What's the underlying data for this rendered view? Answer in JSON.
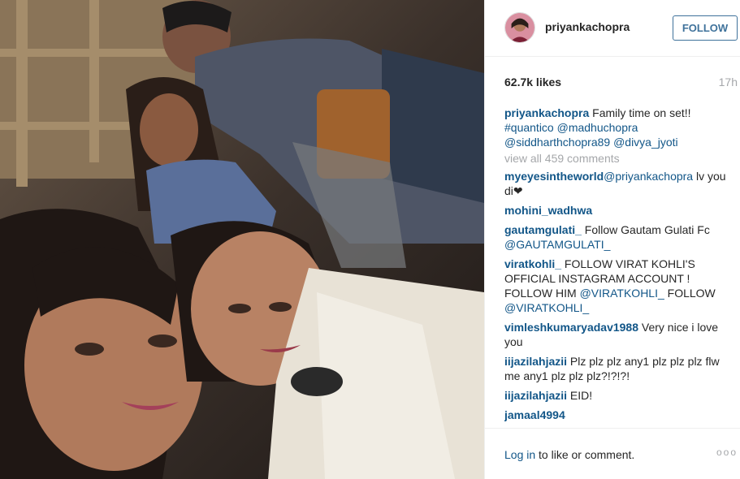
{
  "post": {
    "username": "priyankachopra",
    "follow_label": "FOLLOW",
    "likes": "62.7k likes",
    "time": "17h"
  },
  "caption": {
    "user": "priyankachopra",
    "text": "Family time on set!!",
    "tags": [
      "#quantico",
      "@madhuchopra",
      "@siddharthchopra89",
      "@divya_jyoti"
    ]
  },
  "view_all": "view all 459 comments",
  "comments": [
    {
      "user": "myeyesintheworld",
      "pre": "",
      "tag": "@priyankachopra",
      "post": " lv you di❤"
    },
    {
      "user": "mohini_wadhwa",
      "pre": " ",
      "tag": "",
      "post": ""
    },
    {
      "user": "gautamgulati_",
      "pre": " Follow Gautam Gulati Fc ",
      "tag": "@GAUTAMGULATI_",
      "post": ""
    },
    {
      "user": "viratkohli_",
      "pre": " FOLLOW VIRAT KOHLI'S OFFICIAL INSTAGRAM ACCOUNT ! FOLLOW HIM ",
      "tag": "@VIRATKOHLI_",
      "post": " FOLLOW ",
      "tag2": "@VIRATKOHLI_"
    },
    {
      "user": "vimleshkumaryadav1988",
      "pre": " Very nice i love you",
      "tag": "",
      "post": ""
    },
    {
      "user": "iijazilahjazii",
      "pre": " Plz plz plz any1 plz plz plz flw me any1 plz plz plz?!?!?!",
      "tag": "",
      "post": ""
    },
    {
      "user": "iijazilahjazii",
      "pre": " EID!",
      "tag": "",
      "post": ""
    },
    {
      "user": "jamaal4994",
      "pre": " ",
      "tag": "",
      "post": ""
    }
  ],
  "footer": {
    "login_link": "Log in",
    "login_rest": " to like or comment.",
    "more": "ooo"
  },
  "colors": {
    "link": "#125688",
    "follow": "#3f729b",
    "muted": "#a5a7aa"
  },
  "icons": {
    "more": "more-options-icon"
  }
}
